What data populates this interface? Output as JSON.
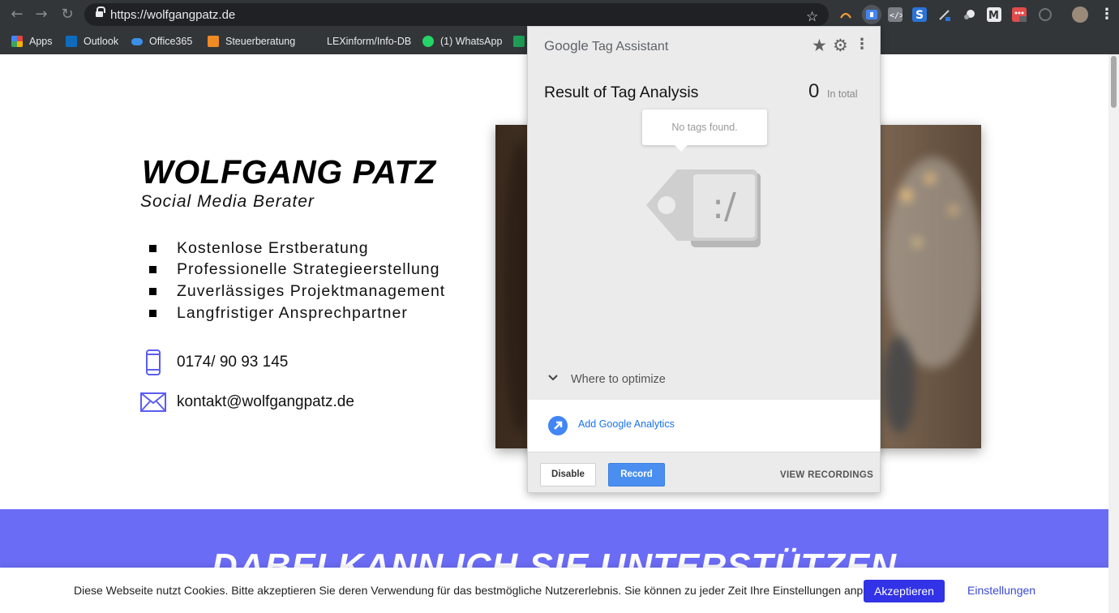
{
  "browser": {
    "url": "https://wolfgangpatz.de",
    "bookmarks": [
      {
        "label": "Apps",
        "icon": "apps-grid-icon",
        "color": "#e8453c"
      },
      {
        "label": "Outlook",
        "icon": "outlook-icon",
        "color": "#0f6cbd"
      },
      {
        "label": "Office365",
        "icon": "onedrive-cloud-icon",
        "color": "#3b8fe8"
      },
      {
        "label": "Steuerberatung",
        "icon": "orange-doc-icon",
        "color": "#f08a24"
      },
      {
        "label": "LEXinform/Info-DB",
        "icon": "",
        "color": ""
      },
      {
        "label": "(1) WhatsApp",
        "icon": "whatsapp-icon",
        "color": "#25d366"
      },
      {
        "label": "",
        "icon": "excel-icon",
        "color": "#1f9d55"
      }
    ]
  },
  "page": {
    "name": "WOLFGANG PATZ",
    "role": "Social Media Berater",
    "features": [
      "Kostenlose Erstberatung",
      "Professionelle Strategieerstellung",
      "Zuverlässiges Projektmanagement",
      "Langfristiger Ansprechpartner"
    ],
    "phone": "0174/ 90 93 145",
    "email": "kontakt@wolfgangpatz.de",
    "banner_title": "DABEI KANN ICH SIE UNTERSTÜTZEN",
    "accent_color": "#6b6cf6"
  },
  "cookie": {
    "text": "Diese Webseite nutzt Cookies. Bitte akzeptieren Sie deren Verwendung für das bestmögliche Nutzererlebnis. Sie können zu jeder Zeit Ihre Einstellungen anpassen.",
    "accept": "Akzeptieren",
    "settings": "Einstellungen"
  },
  "tag_assistant": {
    "brand_google": "Google",
    "brand_product": "Tag Assistant",
    "title": "Result of Tag Analysis",
    "count": "0",
    "count_label": "In total",
    "empty_message": "No tags found.",
    "tag_face": ":/",
    "optimize_label": "Where to optimize",
    "suggestion": "Add Google Analytics",
    "disable": "Disable",
    "record": "Record",
    "view_recordings": "VIEW RECORDINGS"
  }
}
